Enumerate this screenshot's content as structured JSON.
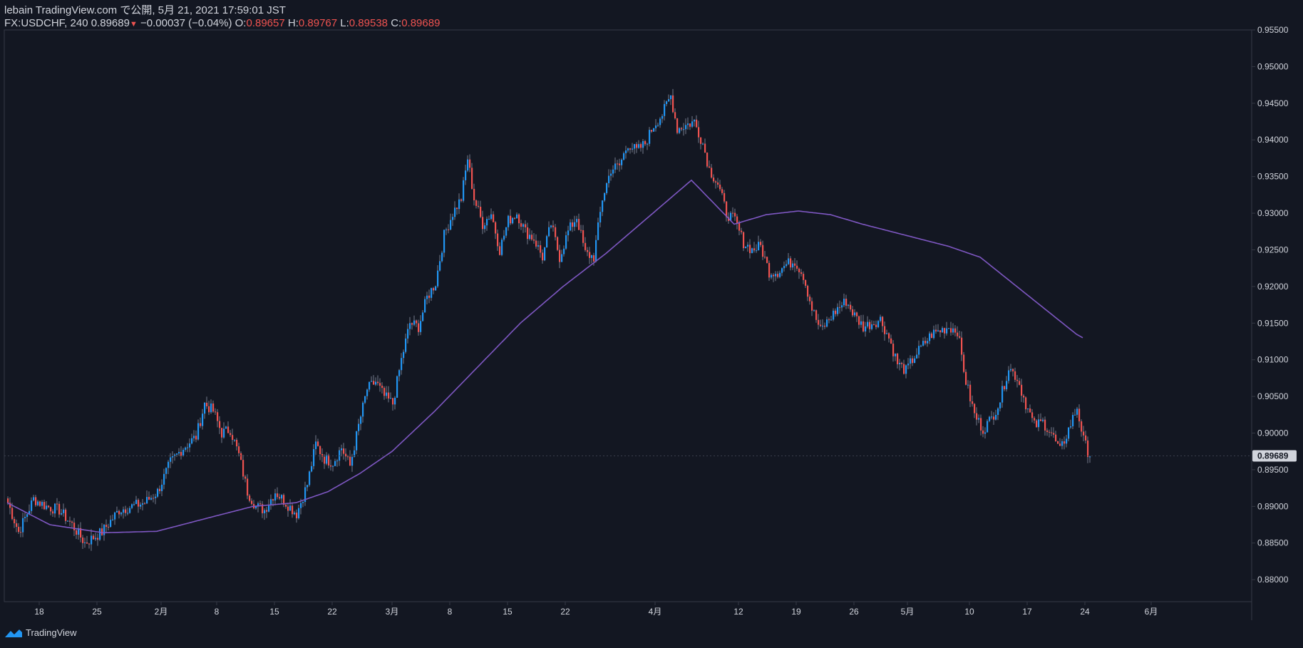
{
  "header": {
    "published_line": "lebain TradingView.com で公開, 5月 21, 2021 17:59:01 JST",
    "symbol_label": "FX:USDCHF, 240",
    "last_price": "0.89689",
    "change_arrow": "▼",
    "change": "−0.00037 (−0.04%)",
    "o_label": "O:",
    "o_value": "0.89657",
    "h_label": "H:",
    "h_value": "0.89767",
    "l_label": "L:",
    "l_value": "0.89538",
    "c_label": "C:",
    "c_value": "0.89689"
  },
  "footer": {
    "brand": "TradingView",
    "logo_icon": "tradingview-logo-icon"
  },
  "colors": {
    "background": "#131722",
    "up": "#2196f3",
    "down": "#ef5350",
    "ma": "#7e57c2",
    "axis_text": "#d1d4dc",
    "price_tag_bg": "#d1d4dc",
    "price_tag_text": "#131722"
  },
  "chart_data": {
    "type": "candlestick",
    "symbol": "FX:USDCHF",
    "interval": "240",
    "y_axis": {
      "range": [
        0.877,
        0.955
      ],
      "ticks": [
        "0.95500",
        "0.95000",
        "0.94500",
        "0.94000",
        "0.93500",
        "0.93000",
        "0.92500",
        "0.92000",
        "0.91500",
        "0.91000",
        "0.90500",
        "0.90000",
        "0.89500",
        "0.89000",
        "0.88500",
        "0.88000"
      ],
      "current_price_label": "0.89689",
      "current_price": 0.89689
    },
    "x_axis": {
      "ticks": [
        {
          "label": "18",
          "bar": 15
        },
        {
          "label": "25",
          "bar": 42
        },
        {
          "label": "2月",
          "bar": 72
        },
        {
          "label": "8",
          "bar": 98
        },
        {
          "label": "15",
          "bar": 125
        },
        {
          "label": "22",
          "bar": 152
        },
        {
          "label": "3月",
          "bar": 180
        },
        {
          "label": "8",
          "bar": 207
        },
        {
          "label": "15",
          "bar": 234
        },
        {
          "label": "22",
          "bar": 261
        },
        {
          "label": "4月",
          "bar": 303
        },
        {
          "label": "12",
          "bar": 342
        },
        {
          "label": "19",
          "bar": 369
        },
        {
          "label": "26",
          "bar": 396
        },
        {
          "label": "5月",
          "bar": 421
        },
        {
          "label": "10",
          "bar": 450
        },
        {
          "label": "17",
          "bar": 477
        },
        {
          "label": "24",
          "bar": 504
        },
        {
          "label": "6月",
          "bar": 535
        }
      ]
    },
    "price_path_anchors": [
      [
        0,
        0.8905
      ],
      [
        5,
        0.8865
      ],
      [
        12,
        0.891
      ],
      [
        18,
        0.89
      ],
      [
        24,
        0.8895
      ],
      [
        30,
        0.8875
      ],
      [
        36,
        0.885
      ],
      [
        44,
        0.8865
      ],
      [
        52,
        0.8895
      ],
      [
        58,
        0.89
      ],
      [
        64,
        0.8905
      ],
      [
        70,
        0.892
      ],
      [
        76,
        0.896
      ],
      [
        82,
        0.898
      ],
      [
        88,
        0.8995
      ],
      [
        92,
        0.904
      ],
      [
        96,
        0.903
      ],
      [
        100,
        0.9
      ],
      [
        104,
        0.9005
      ],
      [
        108,
        0.897
      ],
      [
        112,
        0.892
      ],
      [
        116,
        0.89
      ],
      [
        120,
        0.8895
      ],
      [
        125,
        0.892
      ],
      [
        130,
        0.8905
      ],
      [
        135,
        0.889
      ],
      [
        140,
        0.893
      ],
      [
        144,
        0.8985
      ],
      [
        148,
        0.8965
      ],
      [
        152,
        0.896
      ],
      [
        156,
        0.898
      ],
      [
        160,
        0.8955
      ],
      [
        164,
        0.901
      ],
      [
        168,
        0.906
      ],
      [
        172,
        0.907
      ],
      [
        176,
        0.905
      ],
      [
        180,
        0.904
      ],
      [
        184,
        0.91
      ],
      [
        188,
        0.915
      ],
      [
        192,
        0.9145
      ],
      [
        196,
        0.9185
      ],
      [
        200,
        0.9205
      ],
      [
        204,
        0.927
      ],
      [
        208,
        0.93
      ],
      [
        212,
        0.932
      ],
      [
        215,
        0.9375
      ],
      [
        218,
        0.932
      ],
      [
        222,
        0.9285
      ],
      [
        226,
        0.93
      ],
      [
        230,
        0.925
      ],
      [
        234,
        0.929
      ],
      [
        238,
        0.93
      ],
      [
        242,
        0.9275
      ],
      [
        246,
        0.9265
      ],
      [
        250,
        0.924
      ],
      [
        254,
        0.9285
      ],
      [
        258,
        0.924
      ],
      [
        262,
        0.9275
      ],
      [
        266,
        0.9295
      ],
      [
        270,
        0.9245
      ],
      [
        274,
        0.924
      ],
      [
        278,
        0.932
      ],
      [
        282,
        0.936
      ],
      [
        286,
        0.9365
      ],
      [
        290,
        0.9395
      ],
      [
        294,
        0.9385
      ],
      [
        298,
        0.9395
      ],
      [
        302,
        0.942
      ],
      [
        306,
        0.9435
      ],
      [
        310,
        0.946
      ],
      [
        313,
        0.9415
      ],
      [
        317,
        0.942
      ],
      [
        321,
        0.9425
      ],
      [
        325,
        0.9395
      ],
      [
        328,
        0.936
      ],
      [
        332,
        0.934
      ],
      [
        336,
        0.93
      ],
      [
        340,
        0.929
      ],
      [
        344,
        0.926
      ],
      [
        348,
        0.925
      ],
      [
        352,
        0.9255
      ],
      [
        356,
        0.922
      ],
      [
        360,
        0.922
      ],
      [
        364,
        0.923
      ],
      [
        368,
        0.9235
      ],
      [
        372,
        0.9215
      ],
      [
        376,
        0.917
      ],
      [
        380,
        0.914
      ],
      [
        384,
        0.9155
      ],
      [
        388,
        0.917
      ],
      [
        392,
        0.918
      ],
      [
        396,
        0.916
      ],
      [
        400,
        0.9145
      ],
      [
        404,
        0.915
      ],
      [
        408,
        0.9155
      ],
      [
        412,
        0.913
      ],
      [
        416,
        0.9095
      ],
      [
        420,
        0.9085
      ],
      [
        424,
        0.9105
      ],
      [
        428,
        0.912
      ],
      [
        432,
        0.9135
      ],
      [
        436,
        0.914
      ],
      [
        440,
        0.9145
      ],
      [
        444,
        0.914
      ],
      [
        448,
        0.907
      ],
      [
        452,
        0.9025
      ],
      [
        456,
        0.9005
      ],
      [
        460,
        0.902
      ],
      [
        464,
        0.9045
      ],
      [
        468,
        0.909
      ],
      [
        472,
        0.9075
      ],
      [
        476,
        0.904
      ],
      [
        480,
        0.901
      ],
      [
        484,
        0.9015
      ],
      [
        488,
        0.9
      ],
      [
        492,
        0.8975
      ],
      [
        496,
        0.9005
      ],
      [
        500,
        0.9035
      ],
      [
        503,
        0.899
      ],
      [
        506,
        0.8968
      ]
    ],
    "moving_average": {
      "color": "#7e57c2",
      "anchors": [
        [
          0,
          0.8905
        ],
        [
          20,
          0.8875
        ],
        [
          45,
          0.8864
        ],
        [
          70,
          0.8866
        ],
        [
          95,
          0.8885
        ],
        [
          115,
          0.89
        ],
        [
          135,
          0.8905
        ],
        [
          150,
          0.892
        ],
        [
          165,
          0.8945
        ],
        [
          180,
          0.8975
        ],
        [
          200,
          0.903
        ],
        [
          220,
          0.909
        ],
        [
          240,
          0.915
        ],
        [
          260,
          0.92
        ],
        [
          280,
          0.9245
        ],
        [
          300,
          0.9295
        ],
        [
          320,
          0.9345
        ],
        [
          340,
          0.9285
        ],
        [
          355,
          0.9298
        ],
        [
          370,
          0.9303
        ],
        [
          385,
          0.9298
        ],
        [
          400,
          0.9285
        ],
        [
          420,
          0.927
        ],
        [
          440,
          0.9255
        ],
        [
          455,
          0.924
        ],
        [
          470,
          0.9205
        ],
        [
          485,
          0.917
        ],
        [
          500,
          0.9135
        ],
        [
          503,
          0.913
        ]
      ]
    }
  }
}
